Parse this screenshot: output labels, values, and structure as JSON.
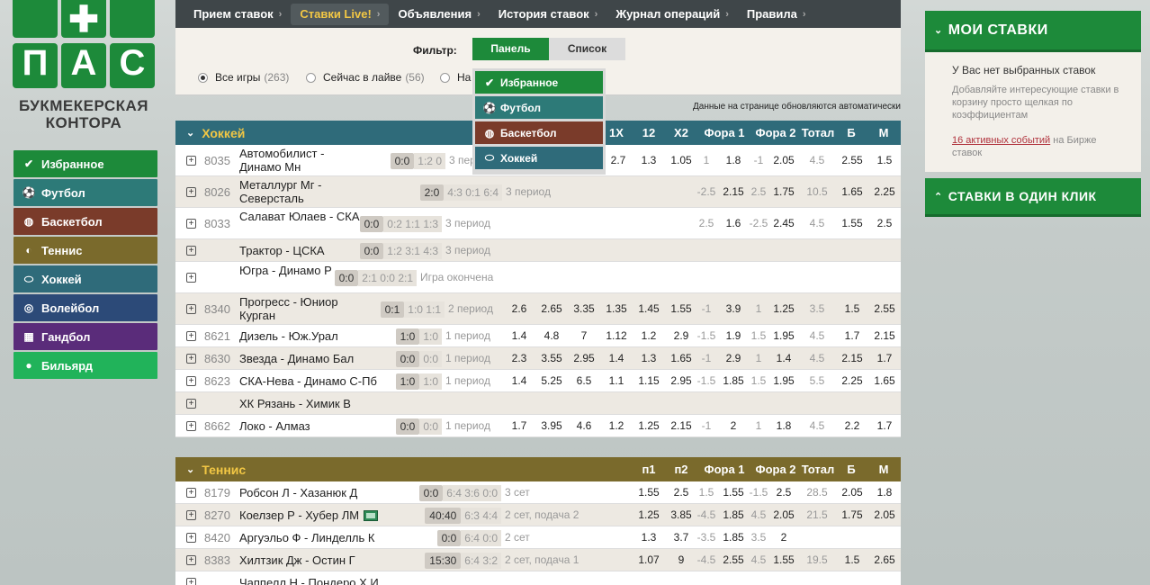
{
  "logo": {
    "tiles": [
      "П",
      "А",
      "С"
    ],
    "line1": "БУКМЕКЕРСКАЯ",
    "line2": "КОНТОРА"
  },
  "sports": [
    {
      "label": "Избранное",
      "color": "#1d8a3a",
      "icon": "check-icon"
    },
    {
      "label": "Футбол",
      "color": "#2d7a78",
      "icon": "soccer-ball-icon"
    },
    {
      "label": "Баскетбол",
      "color": "#7a3b2a",
      "icon": "basketball-icon"
    },
    {
      "label": "Теннис",
      "color": "#7a6a2c",
      "icon": "tennis-ball-icon"
    },
    {
      "label": "Хоккей",
      "color": "#2f6b7a",
      "icon": "hockey-puck-icon"
    },
    {
      "label": "Волейбол",
      "color": "#2c4a78",
      "icon": "volleyball-icon"
    },
    {
      "label": "Гандбол",
      "color": "#5a2c7a",
      "icon": "handball-goal-icon"
    },
    {
      "label": "Бильярд",
      "color": "#21b35a",
      "icon": "billiard-ball-icon"
    }
  ],
  "topnav": [
    {
      "label": "Прием ставок",
      "active": false
    },
    {
      "label": "Ставки Live!",
      "active": true
    },
    {
      "label": "Объявления",
      "active": false
    },
    {
      "label": "История ставок",
      "active": false
    },
    {
      "label": "Журнал операций",
      "active": false
    },
    {
      "label": "Правила",
      "active": false
    }
  ],
  "filter": {
    "label": "Фильтр:",
    "panel_btn": "Панель",
    "list_btn": "Список",
    "radios": [
      {
        "label": "Все игры",
        "count": "(263)",
        "checked": true
      },
      {
        "label": "Сейчас в лайве",
        "count": "(56)",
        "checked": false
      },
      {
        "label": "На",
        "count": "",
        "checked": false
      }
    ],
    "auto_update": "Данные на странице обновляются автоматически"
  },
  "dropdown": [
    {
      "label": "Избранное",
      "color": "#1d8a3a",
      "icon": "check-icon"
    },
    {
      "label": "Футбол",
      "color": "#2d7a78",
      "icon": "soccer-ball-icon"
    },
    {
      "label": "Баскетбол",
      "color": "#7a3b2a",
      "icon": "basketball-icon"
    },
    {
      "label": "Хоккей",
      "color": "#2f6b7a",
      "icon": "hockey-puck-icon"
    }
  ],
  "hockey": {
    "title": "Хоккей",
    "color": "#2f6b7a",
    "cols": [
      "1X",
      "12",
      "X2",
      "Фора 1",
      "Фора 2",
      "Тотал",
      "Б",
      "М"
    ],
    "rows": [
      {
        "id": "8035",
        "teams": "Автомобилист - Динамо Мн",
        "score": "0:0",
        "sets": "1:2 0",
        "status": "3 перв",
        "odds": [
          "2.7",
          "1.3",
          "1.05",
          "1",
          "1.8",
          "-1",
          "2.05",
          "4.5",
          "2.55",
          "1.5"
        ]
      },
      {
        "id": "8026",
        "teams": "Металлург Мг - Северсталь",
        "score": "2:0",
        "sets": "4:3 0:1 6:4",
        "status": "3 период",
        "odds": [
          "",
          "",
          "",
          "-2.5",
          "2.15",
          "2.5",
          "1.75",
          "10.5",
          "1.65",
          "2.25"
        ]
      },
      {
        "id": "8033",
        "teams": "Салават Юлаев - СКА",
        "score": "0:0",
        "sets": "0:2 1:1 1:3",
        "status": "3 период",
        "odds": [
          "",
          "",
          "",
          "2.5",
          "1.6",
          "-2.5",
          "2.45",
          "4.5",
          "1.55",
          "2.5"
        ]
      },
      {
        "id": "",
        "teams": "Трактор - ЦСКА",
        "score": "0:0",
        "sets": "1:2 3:1 4:3",
        "status": "3 период",
        "odds": [
          "",
          "",
          "",
          "",
          "",
          "",
          "",
          "",
          "",
          ""
        ]
      },
      {
        "id": "",
        "teams": "Югра - Динамо Р",
        "score": "0:0",
        "sets": "2:1 0:0 2:1",
        "status": "Игра окончена",
        "odds": [
          "",
          "",
          "",
          "",
          "",
          "",
          "",
          "",
          "",
          ""
        ]
      },
      {
        "id": "8340",
        "teams": "Прогресс - Юниор Курган",
        "score": "0:1",
        "sets": "1:0 1:1",
        "status": "2 период",
        "odds": [
          "2.6",
          "2.65",
          "3.35",
          "1.35",
          "1.45",
          "1.55",
          "-1",
          "3.9",
          "1",
          "1.25",
          "3.5",
          "1.5",
          "2.55"
        ]
      },
      {
        "id": "8621",
        "teams": "Дизель - Юж.Урал",
        "score": "1:0",
        "sets": "1:0",
        "status": "1 период",
        "odds": [
          "1.4",
          "4.8",
          "7",
          "1.12",
          "1.2",
          "2.9",
          "-1.5",
          "1.9",
          "1.5",
          "1.95",
          "4.5",
          "1.7",
          "2.15"
        ]
      },
      {
        "id": "8630",
        "teams": "Звезда - Динамо Бал",
        "score": "0:0",
        "sets": "0:0",
        "status": "1 период",
        "odds": [
          "2.3",
          "3.55",
          "2.95",
          "1.4",
          "1.3",
          "1.65",
          "-1",
          "2.9",
          "1",
          "1.4",
          "4.5",
          "2.15",
          "1.7"
        ]
      },
      {
        "id": "8623",
        "teams": "СКА-Нева - Динамо С-Пб",
        "score": "1:0",
        "sets": "1:0",
        "status": "1 период",
        "odds": [
          "1.4",
          "5.25",
          "6.5",
          "1.1",
          "1.15",
          "2.95",
          "-1.5",
          "1.85",
          "1.5",
          "1.95",
          "5.5",
          "2.25",
          "1.65"
        ]
      },
      {
        "id": "",
        "teams": "ХК Рязань - Химик В",
        "score": "",
        "sets": "",
        "status": "",
        "odds": []
      },
      {
        "id": "8662",
        "teams": "Локо - Алмаз",
        "score": "0:0",
        "sets": "0:0",
        "status": "1 период",
        "odds": [
          "1.7",
          "3.95",
          "4.6",
          "1.2",
          "1.25",
          "2.15",
          "-1",
          "2",
          "1",
          "1.8",
          "4.5",
          "2.2",
          "1.7"
        ]
      }
    ]
  },
  "tennis": {
    "title": "Теннис",
    "color": "#7a6a2c",
    "cols": [
      "п1",
      "п2",
      "Фора 1",
      "Фора 2",
      "Тотал",
      "Б",
      "М"
    ],
    "rows": [
      {
        "id": "8179",
        "teams": "Робсон Л - Хазанюк Д",
        "tv": false,
        "score": "0:0",
        "sets": "6:4 3:6 0:0",
        "status": "3 сет",
        "odds": [
          "1.55",
          "2.5",
          "1.5",
          "1.55",
          "-1.5",
          "2.5",
          "28.5",
          "2.05",
          "1.8"
        ]
      },
      {
        "id": "8270",
        "teams": "Коелзер Р - Хубер ЛМ",
        "tv": true,
        "score": "40:40",
        "sets": "6:3 4:4",
        "status": "2 сет, подача 2",
        "odds": [
          "1.25",
          "3.85",
          "-4.5",
          "1.85",
          "4.5",
          "2.05",
          "21.5",
          "1.75",
          "2.05"
        ]
      },
      {
        "id": "8420",
        "teams": "Аргуэльо Ф - Линделль К",
        "tv": false,
        "score": "0:0",
        "sets": "6:4 0:0",
        "status": "2 сет",
        "odds": [
          "1.3",
          "3.7",
          "-3.5",
          "1.85",
          "3.5",
          "2",
          "",
          "",
          ""
        ]
      },
      {
        "id": "8383",
        "teams": "Хилтзик Дж - Остин Г",
        "tv": false,
        "score": "15:30",
        "sets": "6:4 3:2",
        "status": "2 сет, подача 1",
        "odds": [
          "1.07",
          "9",
          "-4.5",
          "2.55",
          "4.5",
          "1.55",
          "19.5",
          "1.5",
          "2.65"
        ]
      },
      {
        "id": "",
        "teams": "Чаппелл Н - Пондеро Х И",
        "tv": false,
        "score": "",
        "sets": "",
        "status": "",
        "odds": []
      }
    ]
  },
  "right_panel": {
    "title": "МОИ СТАВКИ",
    "empty": "У Вас нет выбранных ставок",
    "hint": "Добавляйте интересующие ставки в корзину просто щелкая по коэффициентам",
    "active_link": "16 активных событий",
    "active_tail": " на Бирже ставок",
    "one_click": "СТАВКИ В ОДИН КЛИК"
  }
}
